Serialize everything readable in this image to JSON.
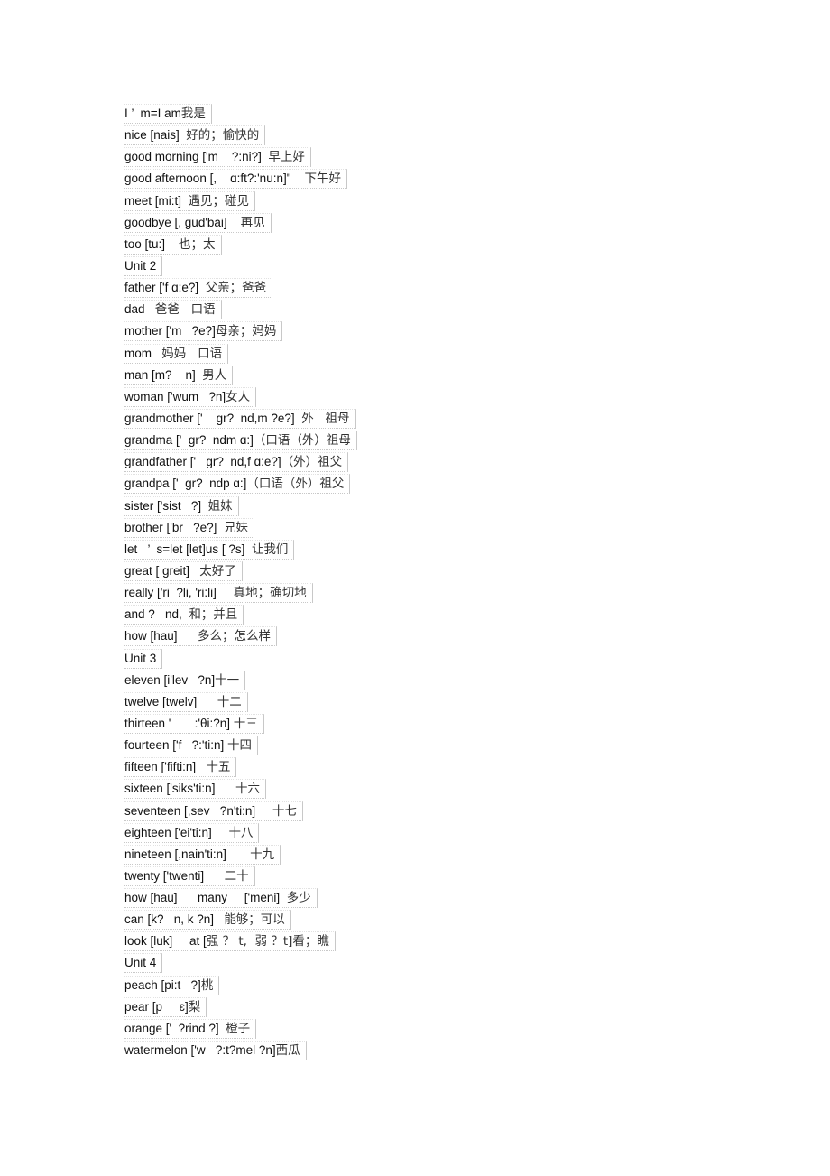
{
  "document": {
    "sections": [
      {
        "heading": null,
        "entries": [
          {
            "en": "I ’  m=I am",
            "zh": "我是"
          },
          {
            "en": "nice [nais]  ",
            "zh": "好的；愉快的"
          },
          {
            "en": "good morning ['m    ?:ni?]  ",
            "zh": "早上好"
          },
          {
            "en": "good afternoon [,    ɑ:ft?:'nu:n]\"    ",
            "zh": "下午好"
          },
          {
            "en": "meet [mi:t]  ",
            "zh": "遇见；碰见"
          },
          {
            "en": "goodbye [, ɡud'bai]    ",
            "zh": "再见"
          },
          {
            "en": "too [tu:]    ",
            "zh": "也；太"
          }
        ]
      },
      {
        "heading": "Unit 2",
        "entries": [
          {
            "en": "father ['f ɑ:e?]  ",
            "zh": "父亲；爸爸"
          },
          {
            "en": "dad   ",
            "zh": "爸爸   口语"
          },
          {
            "en": "mother ['m   ?e?]",
            "zh": "母亲；妈妈"
          },
          {
            "en": "mom   ",
            "zh": "妈妈   口语"
          },
          {
            "en": "man [m?    n]  ",
            "zh": "男人"
          },
          {
            "en": "woman ['wum   ?n]",
            "zh": "女人"
          },
          {
            "en": "grandmother ['    ɡr?  nd,m ?e?]  ",
            "zh": "外   祖母"
          },
          {
            "en": "grandma ['  ɡr?  ndm ɑ:]",
            "zh": "（口语（外）祖母"
          },
          {
            "en": "grandfather ['   ɡr?  nd,f ɑ:e?]",
            "zh": "（外）祖父"
          },
          {
            "en": "grandpa ['  ɡr?  ndp ɑ:]",
            "zh": "（口语（外）祖父"
          },
          {
            "en": "sister ['sist   ?]  ",
            "zh": "姐妹"
          },
          {
            "en": "brother ['br   ?e?]  ",
            "zh": "兄妹"
          },
          {
            "en": "let   ’  s=let [let]us [ ?s]  ",
            "zh": "让我们"
          },
          {
            "en": "great [ ɡreit]   ",
            "zh": "太好了"
          },
          {
            "en": "really ['ri  ?li, 'ri:li]     ",
            "zh": "真地；确切地"
          },
          {
            "en": "and ?   nd,  ",
            "zh": "和；并且"
          },
          {
            "en": "how [hau]      ",
            "zh": "多么；怎么样"
          }
        ]
      },
      {
        "heading": "Unit 3",
        "entries": [
          {
            "en": "eleven [i'lev   ?n]",
            "zh": "十一"
          },
          {
            "en": "twelve [twelv]      ",
            "zh": "十二"
          },
          {
            "en": "thirteen '       :'θi:?n] ",
            "zh": "十三"
          },
          {
            "en": "fourteen ['f   ?:'ti:n] ",
            "zh": "十四"
          },
          {
            "en": "fifteen ['fifti:n]   ",
            "zh": "十五"
          },
          {
            "en": "sixteen ['siks'ti:n]      ",
            "zh": "十六"
          },
          {
            "en": "seventeen [,sev   ?n'ti:n]     ",
            "zh": "十七"
          },
          {
            "en": "eighteen ['ei'ti:n]     ",
            "zh": "十八"
          },
          {
            "en": "nineteen [,nain'ti:n]       ",
            "zh": "十九"
          },
          {
            "en": "twenty ['twenti]      ",
            "zh": "二十"
          },
          {
            "en": "how [hau]      many     ['meni]  ",
            "zh": "多少"
          },
          {
            "en": "can [k?   n, k ?n]   ",
            "zh": "能够；可以"
          },
          {
            "en": "look [luk]     at [",
            "zh": "强 ？ t,  弱 ？t]看；瞧"
          }
        ]
      },
      {
        "heading": "Unit 4",
        "entries": [
          {
            "en": "peach [pi:t   ?]",
            "zh": "桃"
          },
          {
            "en": "pear [p     ɛ]",
            "zh": "梨"
          },
          {
            "en": "orange ['  ?rind ?]  ",
            "zh": "橙子"
          },
          {
            "en": "watermelon ['w   ?:t?mel ?n]",
            "zh": "西瓜"
          }
        ]
      }
    ]
  }
}
